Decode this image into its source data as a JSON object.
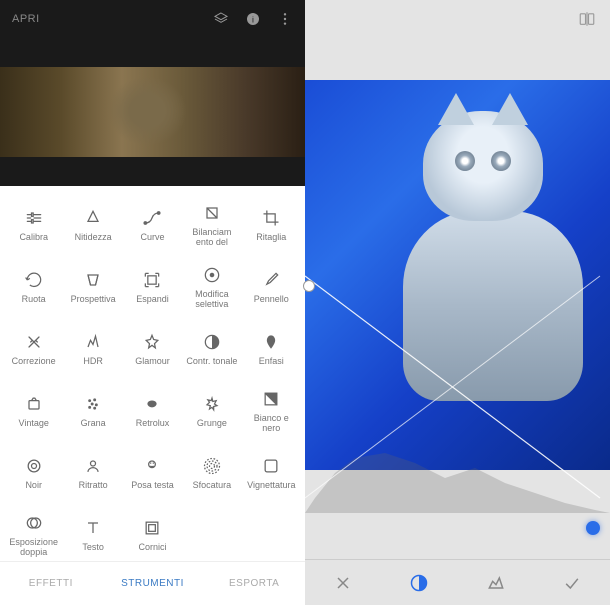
{
  "left": {
    "topbar": {
      "title": "APRI"
    },
    "tools": [
      {
        "id": "calibra",
        "label": "Calibra"
      },
      {
        "id": "nitidezza",
        "label": "Nitidezza"
      },
      {
        "id": "curve",
        "label": "Curve"
      },
      {
        "id": "bilanciamento",
        "label": "Bilanciam ento del"
      },
      {
        "id": "ritaglia",
        "label": "Ritaglia"
      },
      {
        "id": "ruota",
        "label": "Ruota"
      },
      {
        "id": "prospettiva",
        "label": "Prospettiva"
      },
      {
        "id": "espandi",
        "label": "Espandi"
      },
      {
        "id": "modifica-selettiva",
        "label": "Modifica selettiva"
      },
      {
        "id": "pennello",
        "label": "Pennello"
      },
      {
        "id": "correzione",
        "label": "Correzione"
      },
      {
        "id": "hdr",
        "label": "HDR"
      },
      {
        "id": "glamour",
        "label": "Glamour"
      },
      {
        "id": "contr-tonale",
        "label": "Contr. tonale"
      },
      {
        "id": "enfasi",
        "label": "Enfasi"
      },
      {
        "id": "vintage",
        "label": "Vintage"
      },
      {
        "id": "grana",
        "label": "Grana"
      },
      {
        "id": "retrolux",
        "label": "Retrolux"
      },
      {
        "id": "grunge",
        "label": "Grunge"
      },
      {
        "id": "bianco-nero",
        "label": "Bianco e nero"
      },
      {
        "id": "noir",
        "label": "Noir"
      },
      {
        "id": "ritratto",
        "label": "Ritratto"
      },
      {
        "id": "posa-testa",
        "label": "Posa testa"
      },
      {
        "id": "sfocatura",
        "label": "Sfocatura"
      },
      {
        "id": "vignettatura",
        "label": "Vignettatura"
      },
      {
        "id": "esposizione-doppia",
        "label": "Esposizione doppia"
      },
      {
        "id": "testo",
        "label": "Testo"
      },
      {
        "id": "cornici",
        "label": "Cornici"
      }
    ],
    "tabs": [
      {
        "id": "effetti",
        "label": "EFFETTI",
        "active": false
      },
      {
        "id": "strumenti",
        "label": "STRUMENTI",
        "active": true
      },
      {
        "id": "esporta",
        "label": "ESPORTA",
        "active": false
      }
    ]
  },
  "right": {
    "bottom_actions": [
      {
        "id": "close"
      },
      {
        "id": "contrast",
        "active": true
      },
      {
        "id": "levels"
      },
      {
        "id": "apply"
      }
    ]
  }
}
